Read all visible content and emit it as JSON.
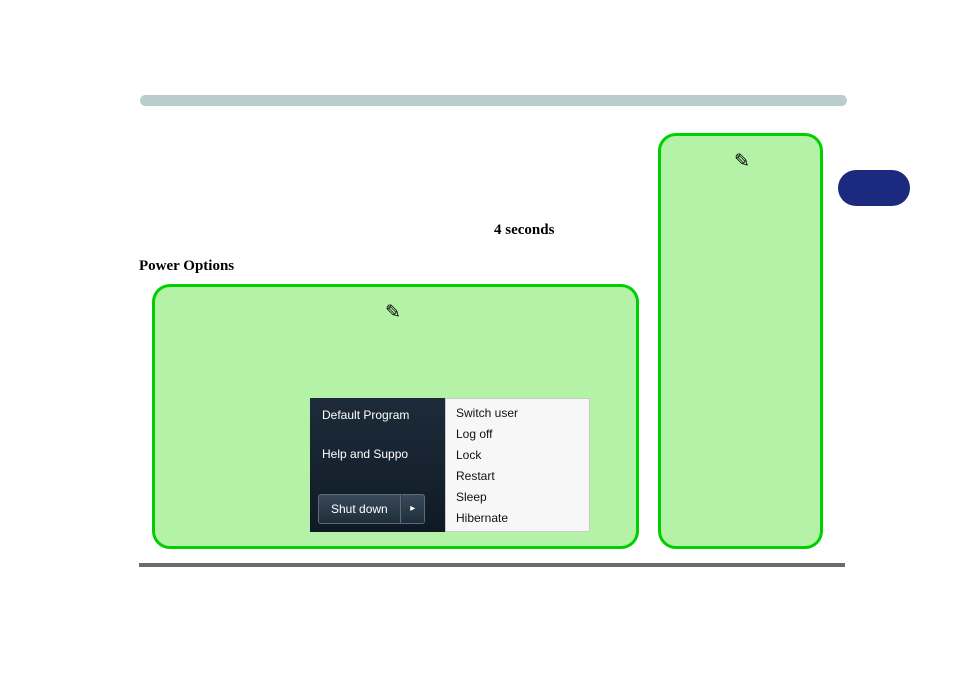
{
  "labels": {
    "four_seconds": "4 seconds",
    "power_options": "Power Options"
  },
  "start_menu": {
    "left": {
      "default_programs": "Default Program",
      "help_support": "Help and Suppo",
      "shutdown": "Shut down"
    },
    "right": [
      "Switch user",
      "Log off",
      "Lock",
      "Restart",
      "Sleep",
      "Hibernate"
    ]
  }
}
